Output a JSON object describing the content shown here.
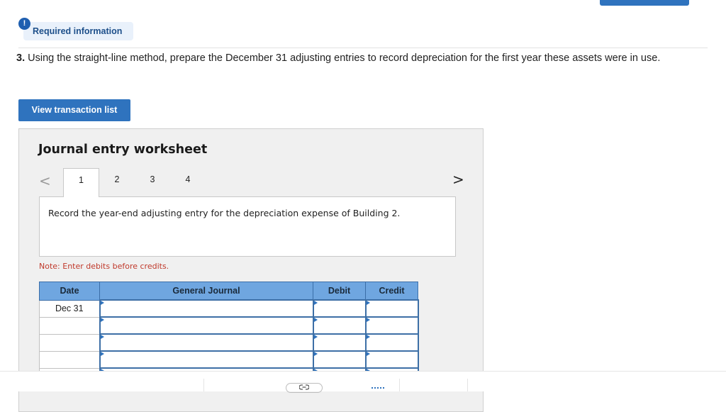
{
  "header": {
    "required_icon": "!",
    "required_label": "Required information"
  },
  "question": {
    "number": "3.",
    "text": "Using the straight-line method, prepare the December 31 adjusting entries to record depreciation for the first year these assets were in use."
  },
  "view_transaction_button": "View transaction list",
  "worksheet": {
    "title": "Journal entry worksheet",
    "prev_icon": "<",
    "next_icon": ">",
    "tabs": [
      "1",
      "2",
      "3",
      "4"
    ],
    "active_tab": "1",
    "instruction": "Record the year-end adjusting entry for the depreciation expense of Building 2.",
    "note": "Note: Enter debits before credits."
  },
  "journal": {
    "columns": [
      "Date",
      "General Journal",
      "Debit",
      "Credit"
    ],
    "rows": [
      {
        "date": "Dec 31",
        "account": "",
        "debit": "",
        "credit": ""
      },
      {
        "date": "",
        "account": "",
        "debit": "",
        "credit": ""
      },
      {
        "date": "",
        "account": "",
        "debit": "",
        "credit": ""
      },
      {
        "date": "",
        "account": "",
        "debit": "",
        "credit": ""
      },
      {
        "date": "",
        "account": "",
        "debit": "",
        "credit": ""
      }
    ]
  },
  "colors": {
    "accent": "#2f73be",
    "table_header": "#6fa6e0",
    "note_red": "#c0392b"
  },
  "icons": {
    "required": "exclamation-icon",
    "prev": "chevron-left-icon",
    "next": "chevron-right-icon",
    "link": "link-icon"
  }
}
